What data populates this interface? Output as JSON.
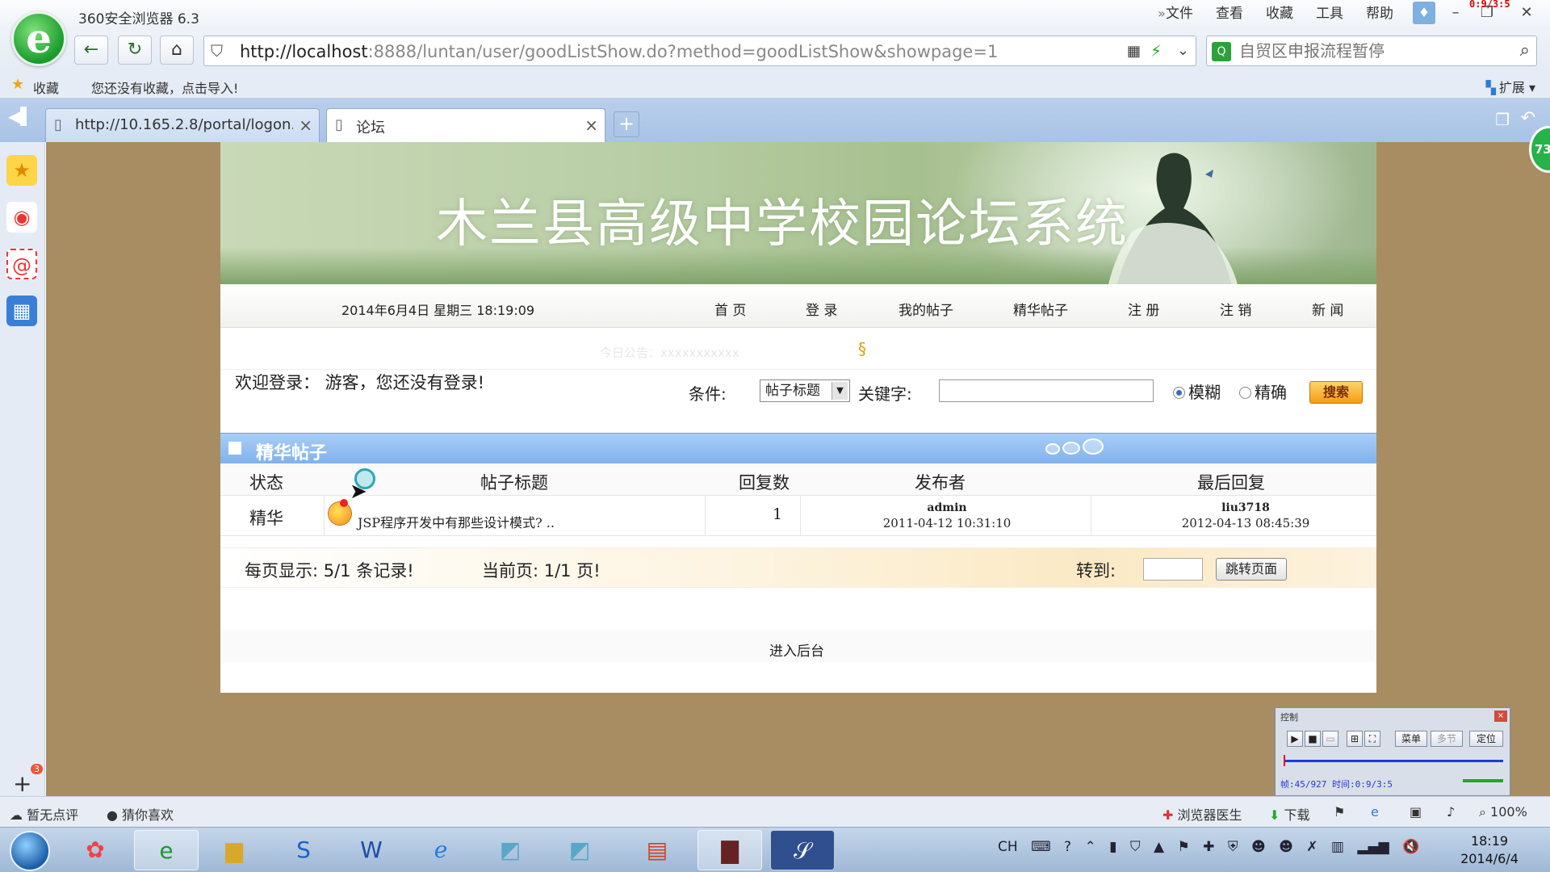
{
  "browser": {
    "app_title": "360安全浏览器 6.3",
    "top_menu": [
      "文件",
      "查看",
      "收藏",
      "工具",
      "帮助"
    ],
    "timer": "0:9/3:5",
    "url_host": "http://localhost",
    "url_rest": ":8888/luntan/user/goodListShow.do?method=goodListShow&showpage=1",
    "search_placeholder": "自贸区申报流程暂停",
    "fav_label": "收藏",
    "fav_hint": "您还没有收藏，点击导入!",
    "ext_label": "扩展",
    "tabs": [
      {
        "label": "http://10.165.2.8/portal/logon.cgi"
      },
      {
        "label": "论坛"
      }
    ],
    "speed_badge": "73"
  },
  "forum": {
    "banner_title": "木兰县高级中学校园论坛系统",
    "clock": "2014年6月4日 星期三  18:19:09",
    "nav": [
      "首 页",
      "登 录",
      "我的帖子",
      "精华帖子",
      "注 册",
      "注 销",
      "新 闻"
    ],
    "marquee": "今日公告：xxxxxxxxxxx",
    "welcome": "欢迎登录： 游客，您还没有登录!",
    "condition_label": "条件:",
    "condition_value": "帖子标题",
    "keyword_label": "关键字:",
    "radio_fuzzy": "模糊",
    "radio_exact": "精确",
    "search_btn": "搜索",
    "section_title": "精华帖子",
    "columns": [
      "状态",
      "帖子标题",
      "回复数",
      "发布者",
      "最后回复"
    ],
    "rows": [
      {
        "status": "精华",
        "title": "JSP程序开发中有那些设计模式? ..",
        "replies": "1",
        "author": "admin",
        "author_time": "2011-04-12 10:31:10",
        "last_reply_user": "liu3718",
        "last_reply_time": "2012-04-13 08:45:39"
      }
    ],
    "pager_per_page": "每页显示: 5/1 条记录!",
    "pager_current": "当前页: 1/1 页!",
    "goto_label": "转到:",
    "goto_btn": "跳转页面",
    "admin_link": "进入后台"
  },
  "player": {
    "title": "控制",
    "menu_btn": "菜单",
    "multi_btn": "多节",
    "locate_btn": "定位",
    "info": "帧:45/927 时间:0:9/3:5"
  },
  "statusbar": {
    "no_review": "暂无点评",
    "guess": "猜你喜欢",
    "doctor": "浏览器医生",
    "download": "下载",
    "zoom": "100%"
  },
  "taskbar": {
    "lang": "CH",
    "time": "18:19",
    "date": "2014/6/4"
  }
}
